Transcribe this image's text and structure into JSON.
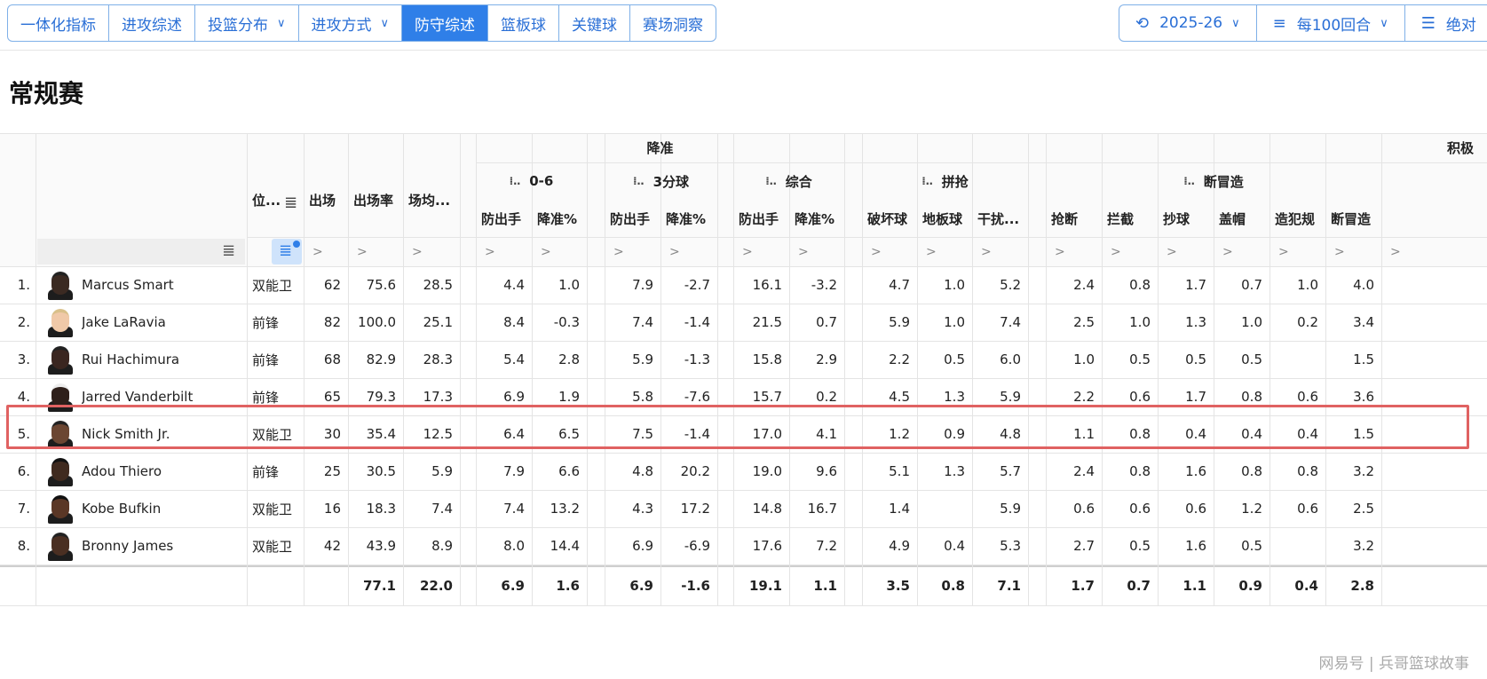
{
  "tabs": [
    {
      "label": "一体化指标",
      "active": false,
      "dropdown": false
    },
    {
      "label": "进攻综述",
      "active": false,
      "dropdown": false
    },
    {
      "label": "投篮分布",
      "active": false,
      "dropdown": true
    },
    {
      "label": "进攻方式",
      "active": false,
      "dropdown": true
    },
    {
      "label": "防守综述",
      "active": true,
      "dropdown": false
    },
    {
      "label": "篮板球",
      "active": false,
      "dropdown": false
    },
    {
      "label": "关键球",
      "active": false,
      "dropdown": false
    },
    {
      "label": "赛场洞察",
      "active": false,
      "dropdown": false
    }
  ],
  "controls": {
    "season": "2025-26",
    "per_mode": "每100回合",
    "mode": "绝对"
  },
  "page_title": "常规赛",
  "groups": {
    "reduce": "降准",
    "active": "积极"
  },
  "subgroups": {
    "zone06": "0-6",
    "three": "3分球",
    "overall": "综合",
    "scramble": "拼抢",
    "steal_create": "断冒造"
  },
  "columns": {
    "pos": "位...",
    "games": "出场",
    "game_pct": "出场率",
    "min": "场均...",
    "fga1": "防出手",
    "red1": "降准%",
    "fga2": "防出手",
    "red2": "降准%",
    "fga3": "防出手",
    "red3": "降准%",
    "deflect": "破坏球",
    "loose": "地板球",
    "contest": "干扰...",
    "stl": "抢断",
    "int": "拦截",
    "strip": "抄球",
    "blk": "盖帽",
    "charge": "造犯规",
    "total": "断冒造"
  },
  "filter_placeholder": ">",
  "rows": [
    {
      "rank": "1.",
      "name": "Marcus Smart",
      "pos": "双能卫",
      "v": [
        "62",
        "75.6",
        "28.5",
        "4.4",
        "1.0",
        "7.9",
        "-2.7",
        "16.1",
        "-3.2",
        "4.7",
        "1.0",
        "5.2",
        "2.4",
        "0.8",
        "1.7",
        "0.7",
        "1.0",
        "4.0"
      ]
    },
    {
      "rank": "2.",
      "name": "Jake LaRavia",
      "pos": "前锋",
      "v": [
        "82",
        "100.0",
        "25.1",
        "8.4",
        "-0.3",
        "7.4",
        "-1.4",
        "21.5",
        "0.7",
        "5.9",
        "1.0",
        "7.4",
        "2.5",
        "1.0",
        "1.3",
        "1.0",
        "0.2",
        "3.4"
      ]
    },
    {
      "rank": "3.",
      "name": "Rui Hachimura",
      "pos": "前锋",
      "v": [
        "68",
        "82.9",
        "28.3",
        "5.4",
        "2.8",
        "5.9",
        "-1.3",
        "15.8",
        "2.9",
        "2.2",
        "0.5",
        "6.0",
        "1.0",
        "0.5",
        "0.5",
        "0.5",
        "",
        "1.5"
      ]
    },
    {
      "rank": "4.",
      "name": "Jarred Vanderbilt",
      "pos": "前锋",
      "v": [
        "65",
        "79.3",
        "17.3",
        "6.9",
        "1.9",
        "5.8",
        "-7.6",
        "15.7",
        "0.2",
        "4.5",
        "1.3",
        "5.9",
        "2.2",
        "0.6",
        "1.7",
        "0.8",
        "0.6",
        "3.6"
      ]
    },
    {
      "rank": "5.",
      "name": "Nick Smith Jr.",
      "pos": "双能卫",
      "v": [
        "30",
        "35.4",
        "12.5",
        "6.4",
        "6.5",
        "7.5",
        "-1.4",
        "17.0",
        "4.1",
        "1.2",
        "0.9",
        "4.8",
        "1.1",
        "0.8",
        "0.4",
        "0.4",
        "0.4",
        "1.5"
      ]
    },
    {
      "rank": "6.",
      "name": "Adou Thiero",
      "pos": "前锋",
      "v": [
        "25",
        "30.5",
        "5.9",
        "7.9",
        "6.6",
        "4.8",
        "20.2",
        "19.0",
        "9.6",
        "5.1",
        "1.3",
        "5.7",
        "2.4",
        "0.8",
        "1.6",
        "0.8",
        "0.8",
        "3.2"
      ]
    },
    {
      "rank": "7.",
      "name": "Kobe Bufkin",
      "pos": "双能卫",
      "v": [
        "16",
        "18.3",
        "7.4",
        "7.4",
        "13.2",
        "4.3",
        "17.2",
        "14.8",
        "16.7",
        "1.4",
        "",
        "5.9",
        "0.6",
        "0.6",
        "0.6",
        "1.2",
        "0.6",
        "2.5"
      ]
    },
    {
      "rank": "8.",
      "name": "Bronny James",
      "pos": "双能卫",
      "v": [
        "42",
        "43.9",
        "8.9",
        "8.0",
        "14.4",
        "6.9",
        "-6.9",
        "17.6",
        "7.2",
        "4.9",
        "0.4",
        "5.3",
        "2.7",
        "0.5",
        "1.6",
        "0.5",
        "",
        "3.2"
      ]
    }
  ],
  "totals": [
    "",
    "77.1",
    "22.0",
    "6.9",
    "1.6",
    "6.9",
    "-1.6",
    "19.1",
    "1.1",
    "3.5",
    "0.8",
    "7.1",
    "1.7",
    "0.7",
    "1.1",
    "0.9",
    "0.4",
    "2.8"
  ],
  "footer": "网易号 | 兵哥篮球故事",
  "colors": {
    "accent": "#2f7fe8",
    "highlight": "#e06262"
  }
}
